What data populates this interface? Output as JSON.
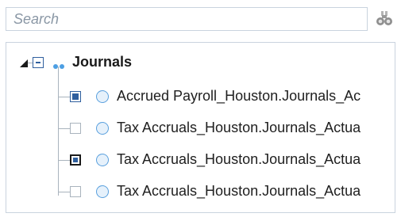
{
  "search": {
    "placeholder": "Search",
    "filter_icon": "binoculars-icon"
  },
  "tree": {
    "root": {
      "label": "Journals",
      "expanded": true,
      "checkbox_state": "partial",
      "icon": "dots-icon"
    },
    "items": [
      {
        "label": "Accrued Payroll_Houston.Journals_Ac",
        "checked": true,
        "icon": "circle-icon"
      },
      {
        "label": "Tax Accruals_Houston.Journals_Actua",
        "checked": false,
        "icon": "circle-icon"
      },
      {
        "label": "Tax Accruals_Houston.Journals_Actua",
        "checked": true,
        "focused": true,
        "icon": "circle-icon"
      },
      {
        "label": "Tax Accruals_Houston.Journals_Actua",
        "checked": false,
        "icon": "circle-icon"
      }
    ]
  },
  "colors": {
    "accent": "#2f5f9e",
    "border": "#c9d3de",
    "node_circle": "#5aa0de"
  }
}
